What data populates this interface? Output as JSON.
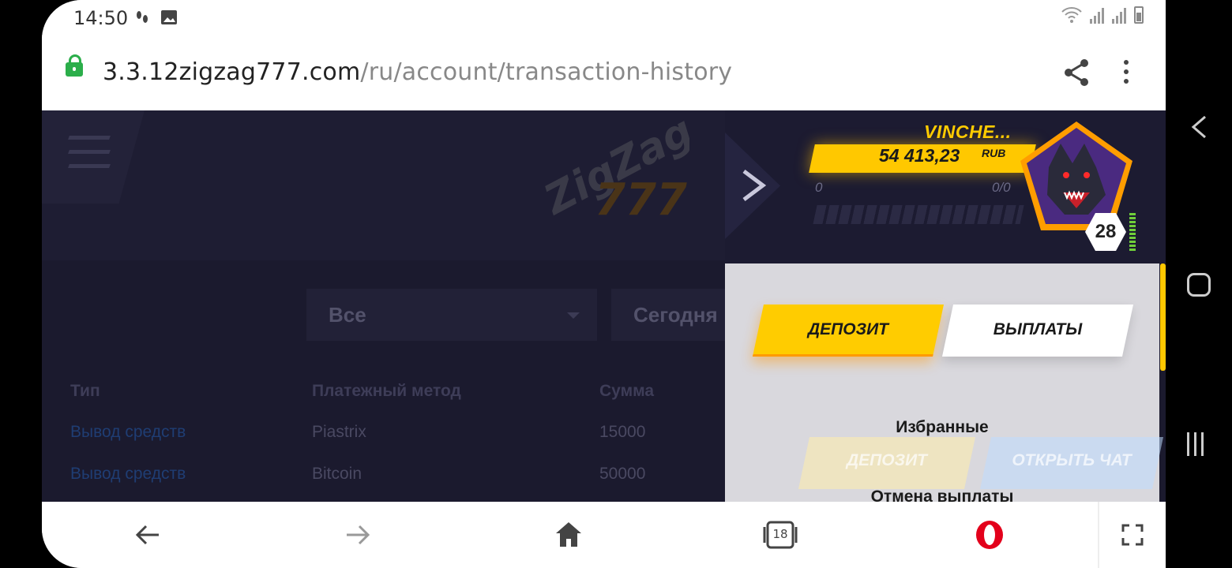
{
  "status_bar": {
    "time": "14:50",
    "left_icons": [
      "steps-icon",
      "image-icon"
    ],
    "right_icons": [
      "wifi-icon",
      "signal-icon",
      "signal-icon",
      "battery-icon"
    ]
  },
  "browser": {
    "url_host": "3.3.12zigzag777.com",
    "url_path": "/ru/account/transaction-history",
    "tab_count": "18"
  },
  "site": {
    "logo_text_top": "ZigZag",
    "logo_text_bottom": "777",
    "filters": {
      "type_value": "Все",
      "period_value": "Сегодня"
    },
    "table": {
      "headers": [
        "Тип",
        "Платежный метод",
        "Сумма"
      ],
      "rows": [
        {
          "type": "Вывод средств",
          "method": "Piastrix",
          "amount": "15000"
        },
        {
          "type": "Вывод средств",
          "method": "Bitcoin",
          "amount": "50000"
        }
      ]
    }
  },
  "panel": {
    "username": "VINCHE...",
    "balance": "54 413,23",
    "currency": "RUB",
    "xp_min": "0",
    "xp_max": "0/0",
    "level": "28",
    "deposit_label": "ДЕПОЗИТ",
    "payouts_label": "ВЫПЛАТЫ",
    "favorites_label": "Избранные",
    "ghost_deposit_label": "ДЕПОЗИТ",
    "ghost_chat_label": "ОТКРЫТЬ ЧАТ",
    "cancel_payout_label": "Отмена выплаты"
  },
  "colors": {
    "accent": "#ffcc00",
    "site_bg": "#1b1a2e",
    "panel_bg": "#d9d8dd",
    "lock": "#2bae4a",
    "opera": "#e3001b"
  }
}
